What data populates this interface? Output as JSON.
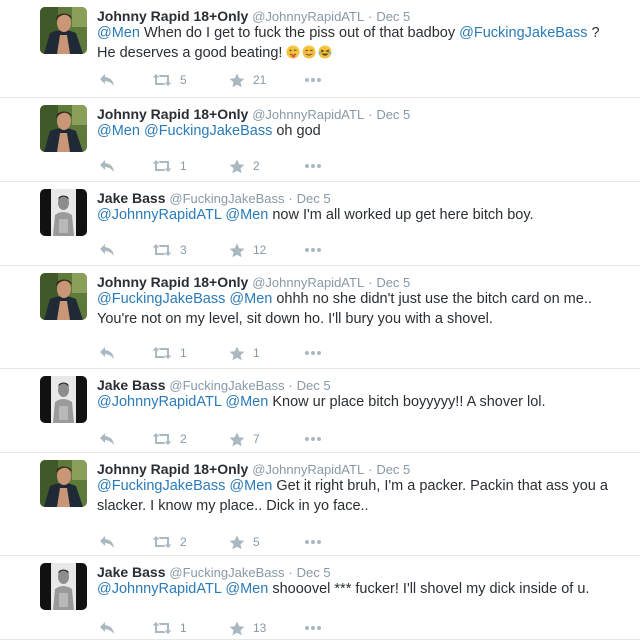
{
  "colors": {
    "link": "#2b7bb9",
    "muted": "#8899a6",
    "icon": "#aab8c2",
    "divider": "#e1e8ed",
    "emoji": "#f5c33b"
  },
  "tweets": [
    {
      "name": "Johnny Rapid 18+Only",
      "handle": "@JohnnyRapidATL",
      "sep": "·",
      "time": "Dec 5",
      "avatar": "johnny-avatar",
      "segments": [
        {
          "t": "@Men",
          "m": true
        },
        {
          "t": " When do I get to fuck the piss out of that badboy ",
          "m": false
        },
        {
          "t": "@FuckingJakeBass",
          "m": true
        },
        {
          "t": " ?",
          "m": false
        },
        {
          "br": true
        },
        {
          "t": "He deserves a good beating! ",
          "m": false
        }
      ],
      "emojis": [
        "tongue-emoji",
        "smirk-emoji",
        "laughing-emoji"
      ],
      "retweets": "5",
      "likes": "21"
    },
    {
      "name": "Johnny Rapid 18+Only",
      "handle": "@JohnnyRapidATL",
      "sep": "·",
      "time": "Dec 5",
      "avatar": "johnny-avatar",
      "segments": [
        {
          "t": "@Men",
          "m": true
        },
        {
          "t": " ",
          "m": false
        },
        {
          "t": "@FuckingJakeBass",
          "m": true
        },
        {
          "t": " oh god",
          "m": false
        }
      ],
      "retweets": "1",
      "likes": "2"
    },
    {
      "name": "Jake Bass",
      "handle": "@FuckingJakeBass",
      "sep": "·",
      "time": "Dec 5",
      "avatar": "jake-avatar",
      "segments": [
        {
          "t": "@JohnnyRapidATL",
          "m": true
        },
        {
          "t": " ",
          "m": false
        },
        {
          "t": "@Men",
          "m": true
        },
        {
          "t": " now I'm all worked up get here bitch boy.",
          "m": false
        }
      ],
      "retweets": "3",
      "likes": "12"
    },
    {
      "name": "Johnny Rapid 18+Only",
      "handle": "@JohnnyRapidATL",
      "sep": "·",
      "time": "Dec 5",
      "avatar": "johnny-avatar",
      "segments": [
        {
          "t": "@FuckingJakeBass",
          "m": true
        },
        {
          "t": " ",
          "m": false
        },
        {
          "t": "@Men",
          "m": true
        },
        {
          "t": " ohhh no she didn't just use the bitch card on me..",
          "m": false
        },
        {
          "br": true
        },
        {
          "t": "You're not on my level, sit down ho. I'll bury you with a shovel.",
          "m": false
        }
      ],
      "retweets": "1",
      "likes": "1"
    },
    {
      "name": "Jake Bass",
      "handle": "@FuckingJakeBass",
      "sep": "·",
      "time": "Dec 5",
      "avatar": "jake-avatar",
      "segments": [
        {
          "t": "@JohnnyRapidATL",
          "m": true
        },
        {
          "t": " ",
          "m": false
        },
        {
          "t": "@Men",
          "m": true
        },
        {
          "t": " Know ur place bitch boyyyyy!! A shover lol.",
          "m": false
        }
      ],
      "retweets": "2",
      "likes": "7"
    },
    {
      "name": "Johnny Rapid 18+Only",
      "handle": "@JohnnyRapidATL",
      "sep": "·",
      "time": "Dec 5",
      "avatar": "johnny-avatar",
      "segments": [
        {
          "t": "@FuckingJakeBass",
          "m": true
        },
        {
          "t": " ",
          "m": false
        },
        {
          "t": "@Men",
          "m": true
        },
        {
          "t": " Get it right bruh, I'm a packer. Packin that ass you a",
          "m": false
        },
        {
          "br": true
        },
        {
          "t": "slacker. I know my place.. Dick in yo face..",
          "m": false
        }
      ],
      "retweets": "2",
      "likes": "5"
    },
    {
      "name": "Jake Bass",
      "handle": "@FuckingJakeBass",
      "sep": "·",
      "time": "Dec 5",
      "avatar": "jake-avatar",
      "segments": [
        {
          "t": "@JohnnyRapidATL",
          "m": true
        },
        {
          "t": " ",
          "m": false
        },
        {
          "t": "@Men",
          "m": true
        },
        {
          "t": " shooovel *** fucker! I'll shovel my dick inside of u.",
          "m": false
        }
      ],
      "retweets": "1",
      "likes": "13"
    }
  ]
}
